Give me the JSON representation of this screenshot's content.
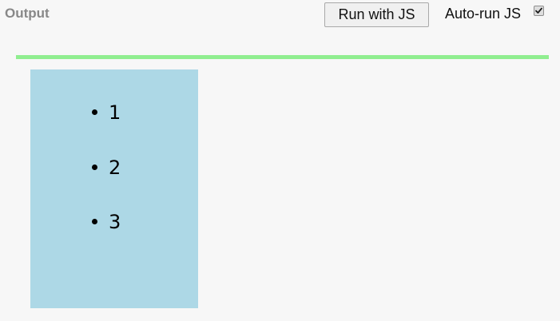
{
  "header": {
    "title": "Output",
    "run_button_label": "Run with JS",
    "autorun_label": "Auto-run JS",
    "autorun_checked": true
  },
  "colors": {
    "divider": "#90ee90",
    "output_background": "#add8e6",
    "page_background": "#f7f7f7"
  },
  "output": {
    "items": [
      "1",
      "2",
      "3"
    ]
  }
}
